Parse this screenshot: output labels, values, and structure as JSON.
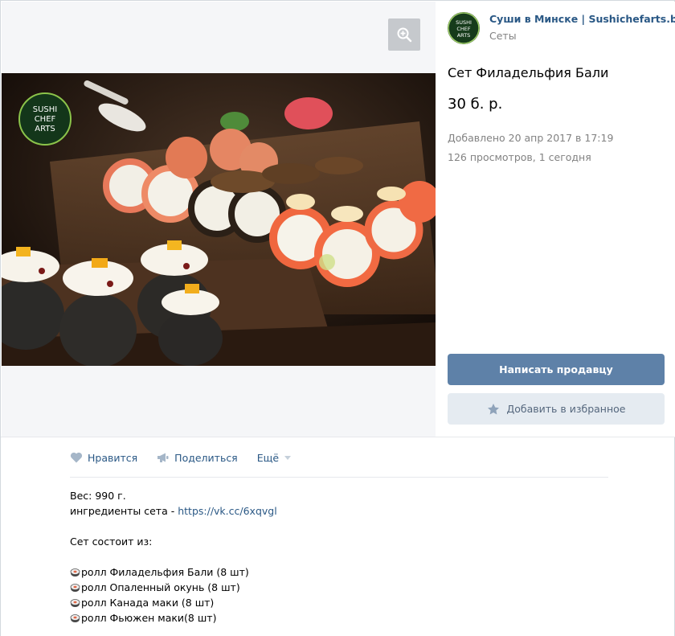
{
  "group": {
    "name": "Суши в Минске | Sushichefarts.by",
    "category": "Сеты",
    "logo_text": [
      "SUSHI",
      "CHEF",
      "ARTS"
    ]
  },
  "item": {
    "title": "Сет Филадельфия Бали",
    "price": "30 б. р.",
    "added": "Добавлено 20 апр 2017 в 17:19",
    "views": "126 просмотров, 1 сегодня"
  },
  "buttons": {
    "write_seller": "Написать продавцу",
    "add_favorite": "Добавить в избранное"
  },
  "actions": {
    "like": "Нравится",
    "share": "Поделиться",
    "more": "Ещё"
  },
  "description": {
    "weight": "Вес: 990 г.",
    "ingredients_label": "ингредиенты сета - ",
    "ingredients_link": "https://vk.cc/6xqvgl",
    "consists_of": "Сет состоит из:",
    "rolls": [
      "ролл Филадельфия Бали (8 шт)",
      "ролл Опаленный окунь (8 шт)",
      "ролл Канада маки (8 шт)",
      "ролл Фьюжен маки(8 шт)"
    ]
  },
  "colors": {
    "link": "#2a5885",
    "primary_button": "#5e81a8",
    "secondary_button": "#e5ebf1",
    "muted_text": "#828282"
  },
  "icons": [
    "zoom-in-icon",
    "heart-icon",
    "megaphone-icon",
    "caret-down-icon",
    "star-icon",
    "sushi-roll-icon"
  ]
}
